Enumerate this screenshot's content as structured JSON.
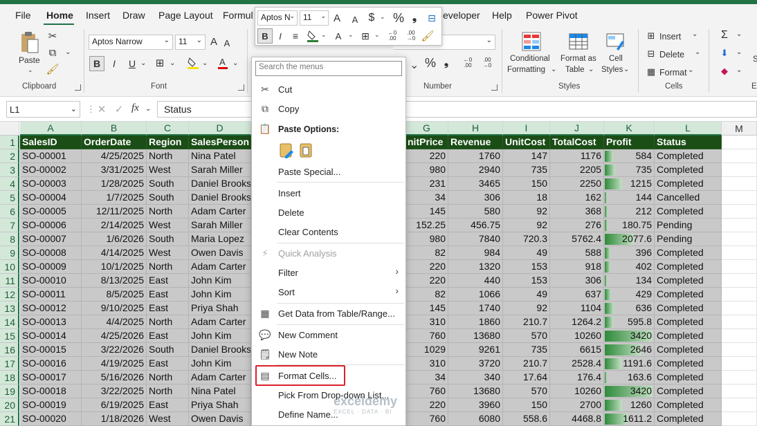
{
  "menu": {
    "tabs": [
      "File",
      "Home",
      "Insert",
      "Draw",
      "Page Layout",
      "Formul",
      "eveloper",
      "Help",
      "Power Pivot"
    ]
  },
  "ribbon": {
    "paste": "Paste",
    "clipboard": "Clipboard",
    "font_name": "Aptos Narrow",
    "font_size": "11",
    "font_group": "Font",
    "number_group": "Number",
    "cond_fmt": [
      "Conditional",
      "Formatting"
    ],
    "fmt_table": [
      "Format as",
      "Table"
    ],
    "cell_styles": [
      "Cell",
      "Styles"
    ],
    "styles_group": "Styles",
    "insert": "Insert",
    "delete": "Delete",
    "format": "Format",
    "cells_group": "Cells",
    "edit_e": "E",
    "edit_s": "S"
  },
  "formula_bar": {
    "name_box": "L1",
    "fx": "fx",
    "content": "Status"
  },
  "columns": [
    "A",
    "B",
    "C",
    "D",
    "G",
    "H",
    "I",
    "J",
    "K",
    "L",
    "M"
  ],
  "headers": [
    "SalesID",
    "OrderDate",
    "Region",
    "SalesPerson",
    "nitPrice",
    "Revenue",
    "UnitCost",
    "TotalCost",
    "Profit",
    "Status"
  ],
  "rows": [
    [
      "SO-00001",
      "4/25/2025",
      "North",
      "Nina Patel",
      "220",
      "1760",
      "147",
      "1176",
      "584",
      "Completed"
    ],
    [
      "SO-00002",
      "3/31/2025",
      "West",
      "Sarah Miller",
      "980",
      "2940",
      "735",
      "2205",
      "735",
      "Completed"
    ],
    [
      "SO-00003",
      "1/28/2025",
      "South",
      "Daniel Brooks",
      "231",
      "3465",
      "150",
      "2250",
      "1215",
      "Completed"
    ],
    [
      "SO-00004",
      "1/7/2025",
      "South",
      "Daniel Brooks",
      "34",
      "306",
      "18",
      "162",
      "144",
      "Cancelled"
    ],
    [
      "SO-00005",
      "12/11/2025",
      "North",
      "Adam Carter",
      "145",
      "580",
      "92",
      "368",
      "212",
      "Completed"
    ],
    [
      "SO-00006",
      "2/14/2025",
      "West",
      "Sarah Miller",
      "152.25",
      "456.75",
      "92",
      "276",
      "180.75",
      "Pending"
    ],
    [
      "SO-00007",
      "1/6/2026",
      "South",
      "Maria Lopez",
      "980",
      "7840",
      "720.3",
      "5762.4",
      "2077.6",
      "Pending"
    ],
    [
      "SO-00008",
      "4/14/2025",
      "West",
      "Owen Davis",
      "82",
      "984",
      "49",
      "588",
      "396",
      "Completed"
    ],
    [
      "SO-00009",
      "10/1/2025",
      "North",
      "Adam Carter",
      "220",
      "1320",
      "153",
      "918",
      "402",
      "Completed"
    ],
    [
      "SO-00010",
      "8/13/2025",
      "East",
      "John Kim",
      "220",
      "440",
      "153",
      "306",
      "134",
      "Completed"
    ],
    [
      "SO-00011",
      "8/5/2025",
      "East",
      "John Kim",
      "82",
      "1066",
      "49",
      "637",
      "429",
      "Completed"
    ],
    [
      "SO-00012",
      "9/10/2025",
      "East",
      "Priya Shah",
      "145",
      "1740",
      "92",
      "1104",
      "636",
      "Completed"
    ],
    [
      "SO-00013",
      "4/4/2025",
      "North",
      "Adam Carter",
      "310",
      "1860",
      "210.7",
      "1264.2",
      "595.8",
      "Completed"
    ],
    [
      "SO-00014",
      "4/25/2026",
      "East",
      "John Kim",
      "760",
      "13680",
      "570",
      "10260",
      "3420",
      "Completed"
    ],
    [
      "SO-00015",
      "3/22/2026",
      "South",
      "Daniel Brooks",
      "1029",
      "9261",
      "735",
      "6615",
      "2646",
      "Completed"
    ],
    [
      "SO-00016",
      "4/19/2025",
      "East",
      "John Kim",
      "310",
      "3720",
      "210.7",
      "2528.4",
      "1191.6",
      "Completed"
    ],
    [
      "SO-00017",
      "5/16/2026",
      "North",
      "Adam Carter",
      "34",
      "340",
      "17.64",
      "176.4",
      "163.6",
      "Completed"
    ],
    [
      "SO-00018",
      "3/22/2025",
      "North",
      "Nina Patel",
      "760",
      "13680",
      "570",
      "10260",
      "3420",
      "Completed"
    ],
    [
      "SO-00019",
      "6/19/2025",
      "East",
      "Priya Shah",
      "220",
      "3960",
      "150",
      "2700",
      "1260",
      "Completed"
    ],
    [
      "SO-00020",
      "1/18/2026",
      "West",
      "Owen Davis",
      "760",
      "6080",
      "558.6",
      "4468.8",
      "1611.2",
      "Completed"
    ]
  ],
  "profit_max": 3420,
  "mini_toolbar": {
    "font": "Aptos N",
    "size": "11"
  },
  "context_menu": {
    "search_placeholder": "Search the menus",
    "cut": "Cut",
    "copy": "Copy",
    "paste_options": "Paste Options:",
    "paste_special": "Paste Special...",
    "insert": "Insert",
    "delete": "Delete",
    "clear_contents": "Clear Contents",
    "quick_analysis": "Quick Analysis",
    "filter": "Filter",
    "sort": "Sort",
    "get_data": "Get Data from Table/Range...",
    "new_comment": "New Comment",
    "new_note": "New Note",
    "format_cells": "Format Cells...",
    "pick_list": "Pick From Drop-down List...",
    "define_name": "Define Name..."
  },
  "watermark": {
    "name": "exceldemy",
    "tag": "EXCEL · DATA · BI"
  },
  "colors": {
    "excel_green": "#217346",
    "header_fill": "#1b4d16",
    "selection": "#c9c9c9",
    "highlight": "#d9212b"
  }
}
